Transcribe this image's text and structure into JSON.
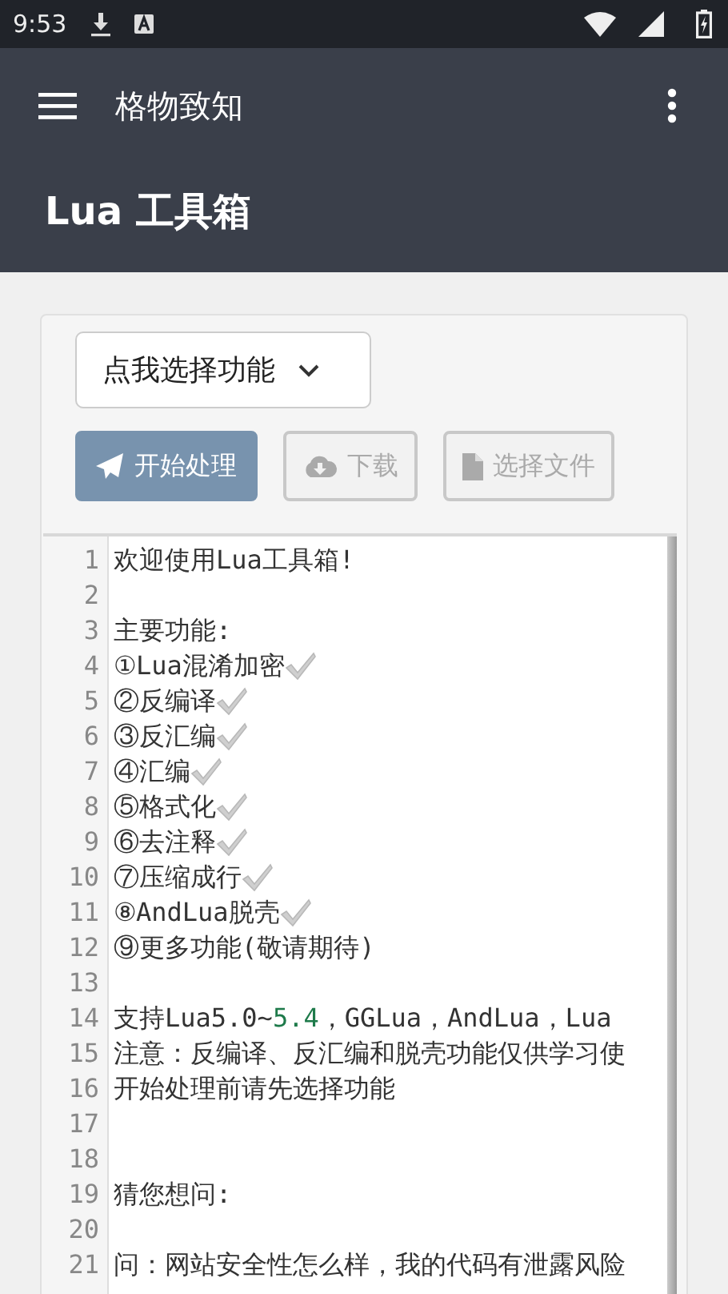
{
  "status_bar": {
    "time": "9:53"
  },
  "app_bar": {
    "title": "格物致知"
  },
  "header": {
    "title": "Lua 工具箱"
  },
  "function_select": {
    "value": "点我选择功能"
  },
  "buttons": [
    {
      "label": "开始处理",
      "kind": "send",
      "disabled": false
    },
    {
      "label": "下载",
      "kind": "download",
      "disabled": true
    },
    {
      "label": "选择文件",
      "kind": "file",
      "disabled": true
    }
  ],
  "editor": {
    "lines": [
      {
        "number": "1",
        "text": "欢迎使用Lua工具箱!"
      },
      {
        "number": "2"
      },
      {
        "number": "3",
        "text": "主要功能:"
      },
      {
        "number": "4",
        "text": "①Lua混淆加密",
        "check": true
      },
      {
        "number": "5",
        "text": "②反编译",
        "check": true
      },
      {
        "number": "6",
        "text": "③反汇编",
        "check": true
      },
      {
        "number": "7",
        "text": "④汇编",
        "check": true
      },
      {
        "number": "8",
        "text": "⑤格式化",
        "check": true
      },
      {
        "number": "9",
        "text": "⑥去注释",
        "check": true
      },
      {
        "number": "10",
        "text": "⑦压缩成行",
        "check": true
      },
      {
        "number": "11",
        "text": "⑧AndLua脱壳",
        "check": true
      },
      {
        "number": "12",
        "text": "⑨更多功能(敬请期待)"
      },
      {
        "number": "13"
      },
      {
        "number": "14",
        "parts": [
          {
            "text": "支持Lua5.0~",
            "kind": "plain"
          },
          {
            "text": "5.4",
            "kind": "number"
          },
          {
            "text": "，GGLua，AndLua，Lua",
            "kind": "plain"
          }
        ]
      },
      {
        "number": "15",
        "text": "注意：反编译、反汇编和脱壳功能仅供学习使"
      },
      {
        "number": "16",
        "text": "开始处理前请先选择功能"
      },
      {
        "number": "17"
      },
      {
        "number": "18"
      },
      {
        "number": "19",
        "text": "猜您想问:"
      },
      {
        "number": "20"
      },
      {
        "number": "21",
        "text": "问：网站安全性怎么样，我的代码有泄露风险"
      }
    ]
  }
}
